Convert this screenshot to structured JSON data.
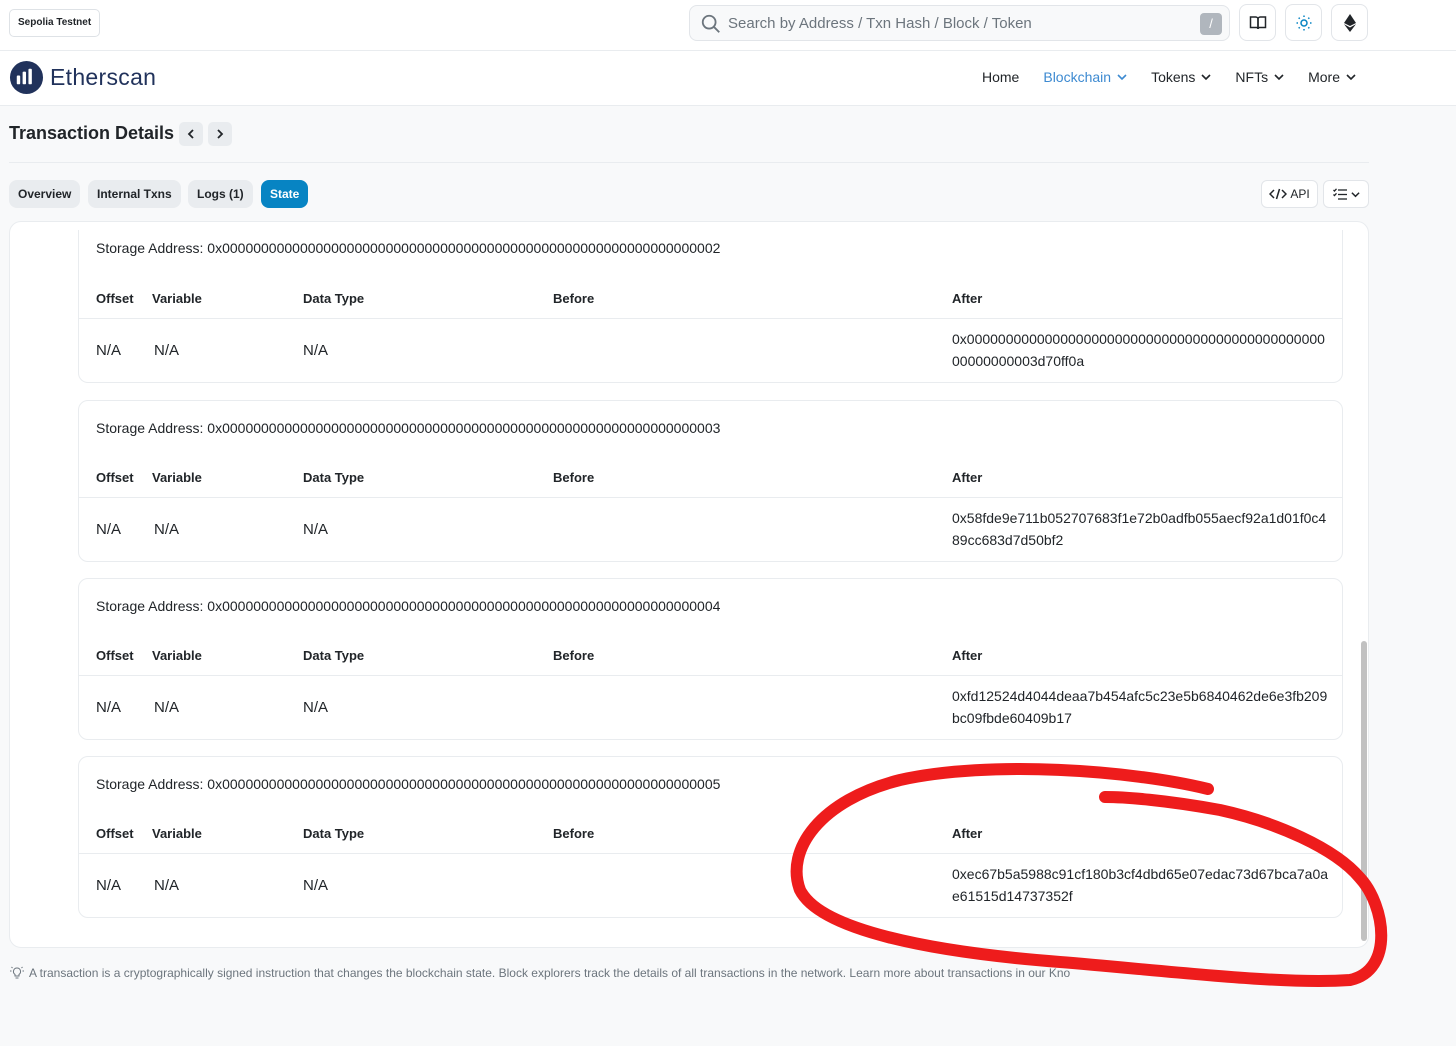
{
  "network_badge": "Sepolia Testnet",
  "search": {
    "placeholder": "Search by Address / Txn Hash / Block / Token",
    "shortcut": "/"
  },
  "brand": "Etherscan",
  "nav": [
    {
      "label": "Home"
    },
    {
      "label": "Blockchain"
    },
    {
      "label": "Tokens"
    },
    {
      "label": "NFTs"
    },
    {
      "label": "More"
    }
  ],
  "page_title": "Transaction Details",
  "tabs": [
    {
      "label": "Overview"
    },
    {
      "label": "Internal Txns"
    },
    {
      "label": "Logs (1)"
    },
    {
      "label": "State"
    }
  ],
  "api_label": "API",
  "columns": {
    "offset": "Offset",
    "variable": "Variable",
    "data_type": "Data Type",
    "before": "Before",
    "after": "After"
  },
  "storage_label": "Storage Address:",
  "storage": [
    {
      "address": "0x0000000000000000000000000000000000000000000000000000000000000002",
      "offset": "N/A",
      "variable": "N/A",
      "data_type": "N/A",
      "before": "",
      "after": "0x000000000000000000000000000000000000000000000000000000003d70ff0a"
    },
    {
      "address": "0x0000000000000000000000000000000000000000000000000000000000000003",
      "offset": "N/A",
      "variable": "N/A",
      "data_type": "N/A",
      "before": "",
      "after": "0x58fde9e711b052707683f1e72b0adfb055aecf92a1d01f0c489cc683d7d50bf2"
    },
    {
      "address": "0x0000000000000000000000000000000000000000000000000000000000000004",
      "offset": "N/A",
      "variable": "N/A",
      "data_type": "N/A",
      "before": "",
      "after": "0xfd12524d4044deaa7b454afc5c23e5b6840462de6e3fb209bc09fbde60409b17"
    },
    {
      "address": "0x0000000000000000000000000000000000000000000000000000000000000005",
      "offset": "N/A",
      "variable": "N/A",
      "data_type": "N/A",
      "before": "",
      "after": "0xec67b5a5988c91cf180b3cf4dbd65e07edac73d67bca7a0ae61515d14737352f"
    }
  ],
  "footer_note": "A transaction is a cryptographically signed instruction that changes the blockchain state. Block explorers track the details of all transactions in the network. Learn more about transactions in our Kno",
  "annotation": {
    "color": "#ee1c1c"
  },
  "colors": {
    "accent": "#0784c3",
    "nav_active": "#3d8ad1",
    "brand": "#21325b"
  }
}
